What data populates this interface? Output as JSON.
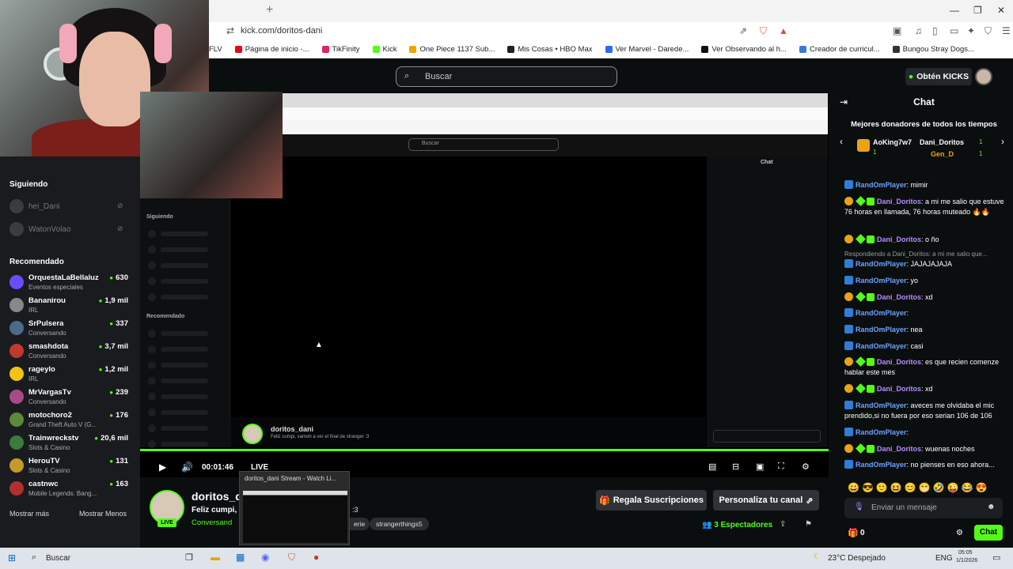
{
  "browser": {
    "new_tab": "+",
    "url": "kick.com/doritos-dani",
    "bookmarks": [
      {
        "label": "FLV",
        "color": "#444444"
      },
      {
        "label": "Página de inicio -...",
        "color": "#e50914"
      },
      {
        "label": "TikFinity",
        "color": "#e0245e"
      },
      {
        "label": "Kick",
        "color": "#53fc18"
      },
      {
        "label": "One Piece 1137 Sub...",
        "color": "#f0a500"
      },
      {
        "label": "Mis Cosas • HBO Max",
        "color": "#222222"
      },
      {
        "label": "Ver Marvel - Darede...",
        "color": "#2a6df4"
      },
      {
        "label": "Ver Observando al h...",
        "color": "#111111"
      },
      {
        "label": "Creador de curricul...",
        "color": "#3a7bd5"
      },
      {
        "label": "Bungou Stray Dogs...",
        "color": "#333333"
      }
    ]
  },
  "kick": {
    "search_placeholder": "Buscar",
    "kicks_button": "Obtén KICKS"
  },
  "sidebar": {
    "following_title": "Siguiendo",
    "following": [
      "hei_Dani",
      "WatonVolao"
    ],
    "recommended_title": "Recomendado",
    "recommended": [
      {
        "name": "OrquestaLaBellaluz",
        "category": "Eventos especiales",
        "viewers": "630",
        "color": "#6a4cff"
      },
      {
        "name": "Bananirou",
        "category": "IRL",
        "viewers": "1,9 mil",
        "color": "#888888"
      },
      {
        "name": "SrPulsera",
        "category": "Conversando",
        "viewers": "337",
        "color": "#4d6a8a"
      },
      {
        "name": "smashdota",
        "category": "Conversando",
        "viewers": "3,7 mil",
        "color": "#c0392b"
      },
      {
        "name": "rageylo",
        "category": "IRL",
        "viewers": "1,2 mil",
        "color": "#f1c40f"
      },
      {
        "name": "MrVargasTv",
        "category": "Conversando",
        "viewers": "239",
        "color": "#a84a8a"
      },
      {
        "name": "motochoro2",
        "category": "Grand Theft Auto V (G...",
        "viewers": "176",
        "color": "#5a8a3a"
      },
      {
        "name": "Trainwreckstv",
        "category": "Slots & Casino",
        "viewers": "20,6 mil",
        "color": "#3b7a3b"
      },
      {
        "name": "HerouTV",
        "category": "Slots & Casino",
        "viewers": "131",
        "color": "#c49a2a"
      },
      {
        "name": "castnwc",
        "category": "Mobile Legends: Bang...",
        "viewers": "163",
        "color": "#b03030"
      }
    ],
    "show_more": "Mostrar más",
    "show_less": "Mostrar Menos"
  },
  "inner": {
    "siguiendo": "Siguiendo",
    "recomendado": "Recomendado",
    "chat": "Chat",
    "buscar": "Buscar",
    "streamer": "doritos_dani",
    "title": "Feliz cumpi, vamoh a ver el final de stranger :3"
  },
  "player": {
    "time": "00:01:46",
    "live": "LIVE",
    "progress": 1.0
  },
  "stream": {
    "name": "doritos_d",
    "title": "Feliz cumpi,",
    "category": "Conversand",
    "title_suffix": ":3",
    "tags": [
      "erie",
      "strangerthings5"
    ],
    "live_badge": "LIVE",
    "gift_button": "Regala Suscripciones",
    "customize_button": "Personaliza tu canal",
    "viewers_count": "3",
    "viewers_label": "Espectadores"
  },
  "thumbnail": {
    "title": "doritos_dani Stream - Watch Li..."
  },
  "chat": {
    "header": "Chat",
    "donors_title": "Mejores donadores de todos los tiempos",
    "donors": [
      {
        "name": "AoKing7w7",
        "amount": "1"
      },
      {
        "name": "Dani_Doritos",
        "amount": "1"
      },
      {
        "name": "Gen_D",
        "amount": "1"
      }
    ],
    "messages": [
      {
        "user": "RandOmPlayer",
        "type": "r",
        "text": ": mimir"
      },
      {
        "user": "Dani_Doritos",
        "type": "d",
        "text": ": a mi me salio que estuve 76 horas en llamada, 76 horas muteado 🔥🔥"
      },
      {
        "user": "Dani_Doritos",
        "type": "d",
        "text": ": o ño"
      },
      {
        "user": "RandOmPlayer",
        "type": "r",
        "text": ": JAJAJAJAJA",
        "reply": "Respondiendo a Dani_Doritos: a mi me salio que..."
      },
      {
        "user": "RandOmPlayer",
        "type": "r",
        "text": ": yo"
      },
      {
        "user": "Dani_Doritos",
        "type": "d",
        "text": ": xd"
      },
      {
        "user": "RandOmPlayer",
        "type": "r",
        "text": ":"
      },
      {
        "user": "RandOmPlayer",
        "type": "r",
        "text": ": nea"
      },
      {
        "user": "RandOmPlayer",
        "type": "r",
        "text": ": casi"
      },
      {
        "user": "Dani_Doritos",
        "type": "d",
        "text": ": es que recien comenze hablar este mes"
      },
      {
        "user": "Dani_Doritos",
        "type": "d",
        "text": ": xd"
      },
      {
        "user": "RandOmPlayer",
        "type": "r",
        "text": ": aveces me olvidaba el mic prendido,si no fuera por eso serian 106 de 106"
      },
      {
        "user": "RandOmPlayer",
        "type": "r",
        "text": ":"
      },
      {
        "user": "Dani_Doritos",
        "type": "d",
        "text": ": wuenas noches"
      },
      {
        "user": "RandOmPlayer",
        "type": "r",
        "text": ": no pienses en eso ahora..."
      }
    ],
    "input_placeholder": "Enviar un mensaje",
    "points": "0",
    "send_button": "Chat"
  },
  "taskbar": {
    "search": "Buscar",
    "weather": "23°C  Despejado",
    "lang": "ENG",
    "time": "05:05",
    "date": "1/1/2026"
  }
}
